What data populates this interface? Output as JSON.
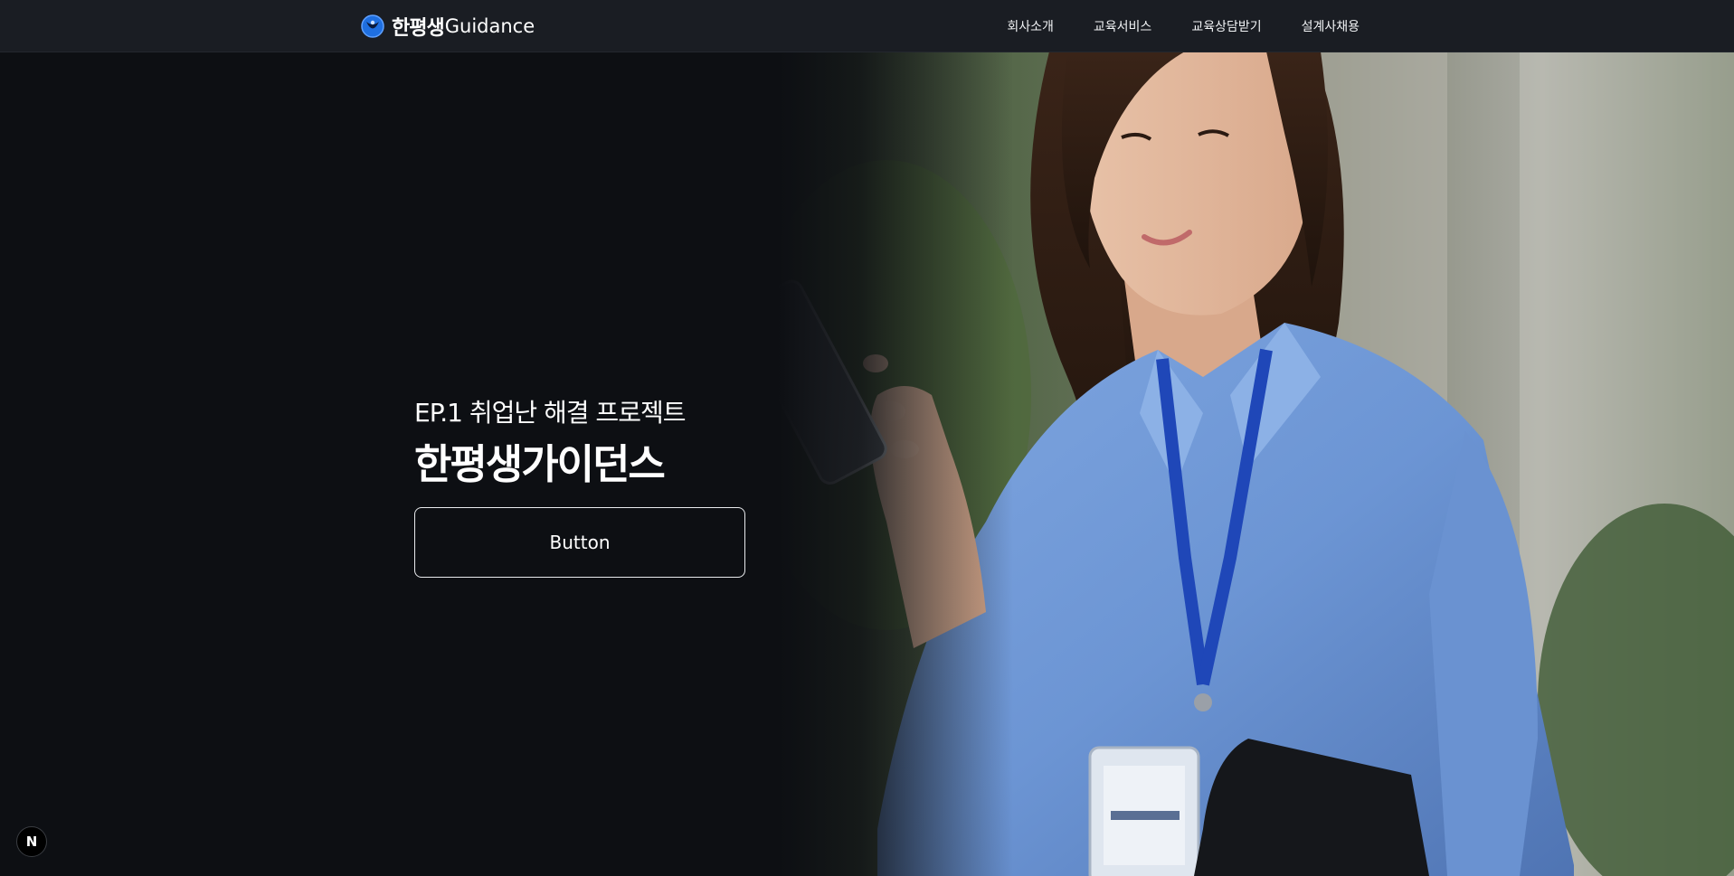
{
  "header": {
    "logo_ko": "한평생",
    "logo_en": "Guidance",
    "nav": [
      {
        "label": "회사소개"
      },
      {
        "label": "교육서비스"
      },
      {
        "label": "교육상담받기"
      },
      {
        "label": "설계사채용"
      }
    ]
  },
  "hero": {
    "subtitle": "EP.1 취업난 해결 프로젝트",
    "title": "한평생가이던스",
    "button_label": "Button",
    "image": "woman-holding-smartphone-photo"
  },
  "badge": {
    "label": "N",
    "icon": "nextjs-icon"
  },
  "colors": {
    "background": "#0d0f13",
    "header": "#1a1d23",
    "logo_blue": "#1f6fe0",
    "shirt": "#6f9ad8",
    "lanyard": "#1f47b8"
  }
}
